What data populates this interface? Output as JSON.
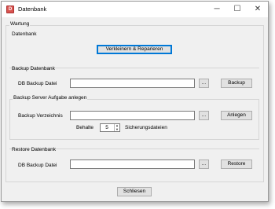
{
  "window": {
    "title": "Datenbank",
    "icon": "database-icon",
    "controls": {
      "minimize": "─",
      "maximize": "☐",
      "close": "✕"
    }
  },
  "wartung": {
    "group_label": "Wartung",
    "datenbank_section": "Datenbank",
    "repair_button": "Verkleinern & Reparieren"
  },
  "backup": {
    "section_label": "Backup Datenbank",
    "file_label": "DB Backup Datei",
    "file_value": "",
    "browse_button": "...",
    "action_button": "Backup"
  },
  "server_task": {
    "group_label": "Backup Server Aufgabe anlegen",
    "dir_label": "Backup Verzeichnis",
    "dir_value": "",
    "browse_button": "...",
    "action_button": "Anlegen",
    "keep_label": "Behalte",
    "keep_value": "5",
    "keep_suffix": "Sicherungsdateien"
  },
  "restore": {
    "section_label": "Restore Datenbank",
    "file_label": "DB Backup Datei",
    "file_value": "",
    "browse_button": "...",
    "action_button": "Restore"
  },
  "footer": {
    "close_button": "Schliesen"
  }
}
